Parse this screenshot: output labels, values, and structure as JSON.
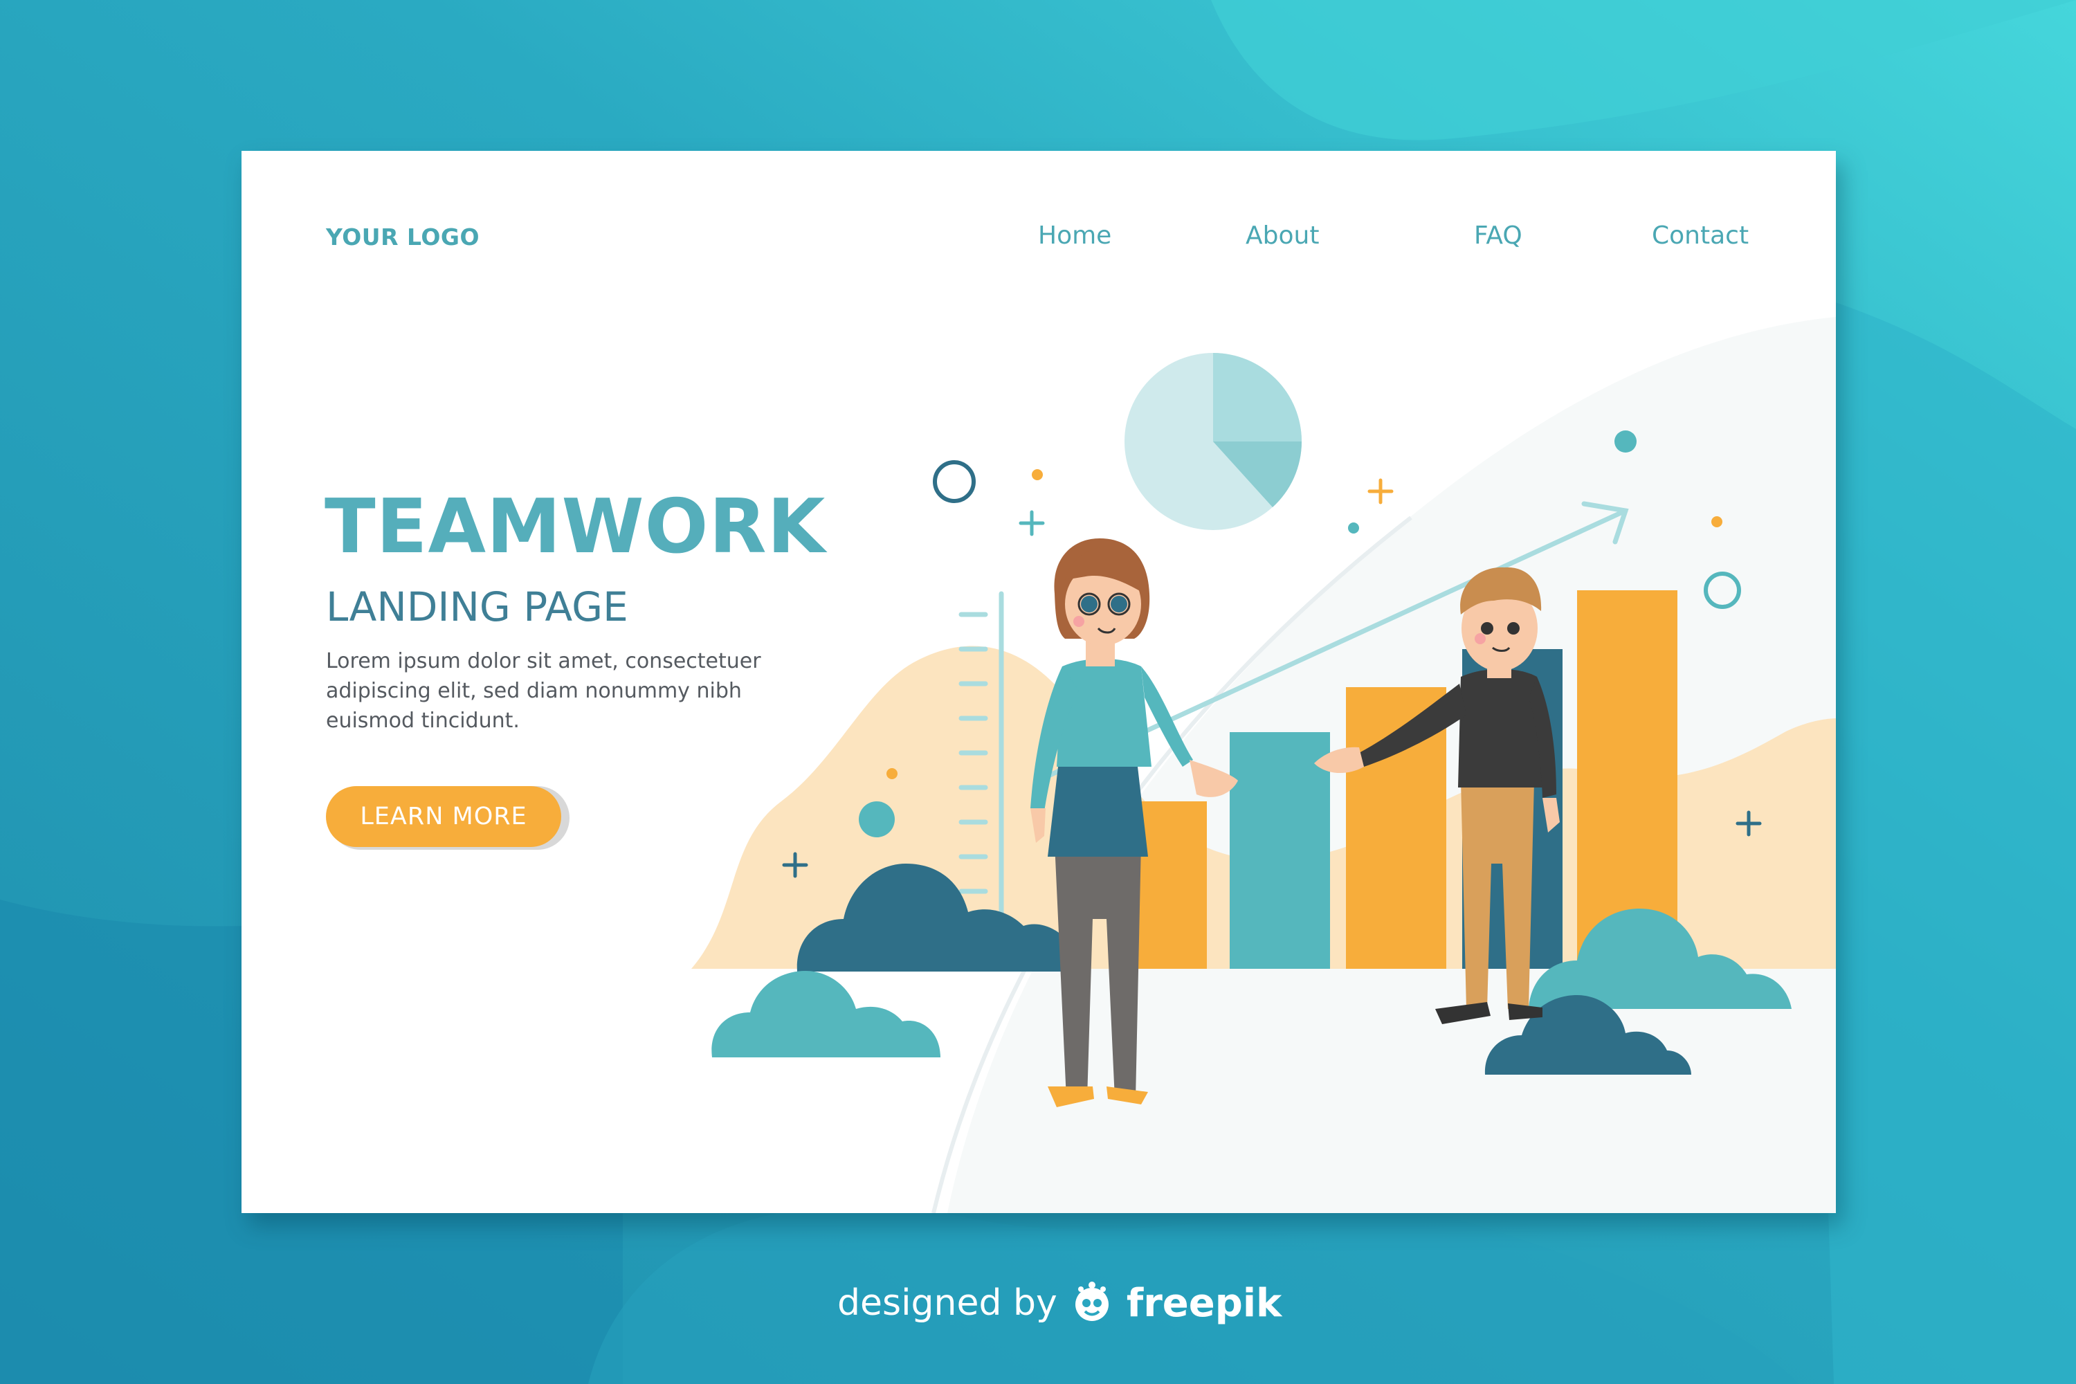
{
  "header": {
    "logo": "YOUR LOGO",
    "nav": [
      "Home",
      "About",
      "FAQ",
      "Contact"
    ]
  },
  "hero": {
    "title": "TEAMWORK",
    "subtitle": "LANDING PAGE",
    "description": "Lorem ipsum dolor sit amet, consectetuer adipiscing elit, sed diam nonummy nibh euismod tincidunt.",
    "cta_label": "LEARN MORE"
  },
  "footer": {
    "credit_prefix": "designed by",
    "credit_brand": "freepik"
  },
  "icons": [
    "freepik-logo-icon",
    "plus-icon",
    "ring-icon",
    "dot-icon",
    "arrow-icon",
    "pie-chart-icon"
  ],
  "colors": {
    "background": "#2aa6c0",
    "teal_text": "#4aa7b3",
    "navy": "#3f7f96",
    "orange": "#f7ad3b",
    "teal_bar": "#55b7bd",
    "dark_teal": "#2f6f88",
    "sand": "#fce4bf",
    "light_teal": "#a9dcdf"
  }
}
